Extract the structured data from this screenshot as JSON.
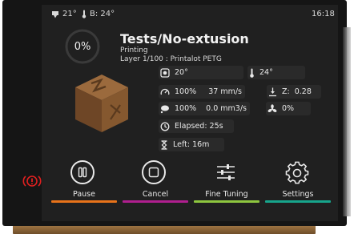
{
  "header": {
    "extruder_temp": "21°",
    "bed_label": "B: 24°",
    "time": "16:18"
  },
  "job": {
    "progress_text": "0%",
    "progress_fraction": 0.0,
    "title": "Tests/No-extusion",
    "status": "Printing",
    "layer_line": "Layer 1/100 : Printalot PETG"
  },
  "stats": {
    "chamber_temp": "20°",
    "ambient_temp": "24°",
    "speed_factor": "100%",
    "speed": "37 mm/s",
    "z_label": "Z:",
    "z_value": "0.28",
    "flow_factor": "100%",
    "flow": "0.0 mm3/s",
    "fan": "0%",
    "elapsed": "Elapsed:  25s",
    "left": "Left:  16m"
  },
  "actions": [
    {
      "label": "Pause",
      "accent": "#e8731a"
    },
    {
      "label": "Cancel",
      "accent": "#b01f8f"
    },
    {
      "label": "Fine Tuning",
      "accent": "#8ec63f"
    },
    {
      "label": "Settings",
      "accent": "#17a58c"
    }
  ],
  "colors": {
    "screen_bg": "#202020",
    "estop": "#e02020"
  }
}
